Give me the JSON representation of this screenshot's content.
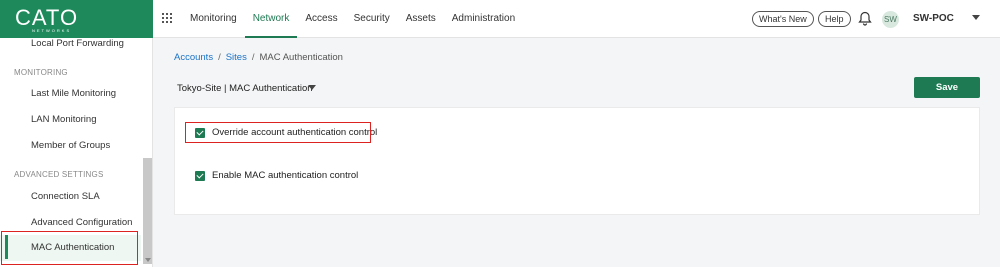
{
  "logo": {
    "main": "CATO",
    "sub": "NETWORKS"
  },
  "nav": [
    {
      "label": "Monitoring"
    },
    {
      "label": "Network",
      "active": true
    },
    {
      "label": "Access"
    },
    {
      "label": "Security"
    },
    {
      "label": "Assets"
    },
    {
      "label": "Administration"
    }
  ],
  "header": {
    "whats_new": "What's New",
    "help": "Help",
    "avatar_initials": "SW",
    "account": "SW-POC",
    "icons": [
      "apps-grid-icon",
      "bell-icon",
      "chevron-down-icon"
    ]
  },
  "sidebar": {
    "items_top": [
      {
        "label": "Local Port Forwarding"
      }
    ],
    "section_monitoring": "MONITORING",
    "items_monitoring": [
      {
        "label": "Last Mile Monitoring"
      },
      {
        "label": "LAN Monitoring"
      },
      {
        "label": "Member of Groups"
      }
    ],
    "section_advanced": "ADVANCED SETTINGS",
    "items_advanced": [
      {
        "label": "Connection SLA"
      },
      {
        "label": "Advanced Configuration"
      },
      {
        "label": "MAC Authentication",
        "active": true
      }
    ]
  },
  "breadcrumb": {
    "accounts": "Accounts",
    "sites": "Sites",
    "current": "MAC Authentication",
    "separator": "/"
  },
  "page": {
    "site_selector": "Tokyo-Site | MAC Authentication",
    "save_label": "Save",
    "options": [
      {
        "label": "Override account authentication control",
        "checked": true
      },
      {
        "label": "Enable MAC authentication control",
        "checked": true
      }
    ]
  },
  "colors": {
    "brand": "#1e8a5c",
    "accent": "#1e7a52",
    "link": "#1a73c8",
    "highlight": "#dd2222"
  }
}
